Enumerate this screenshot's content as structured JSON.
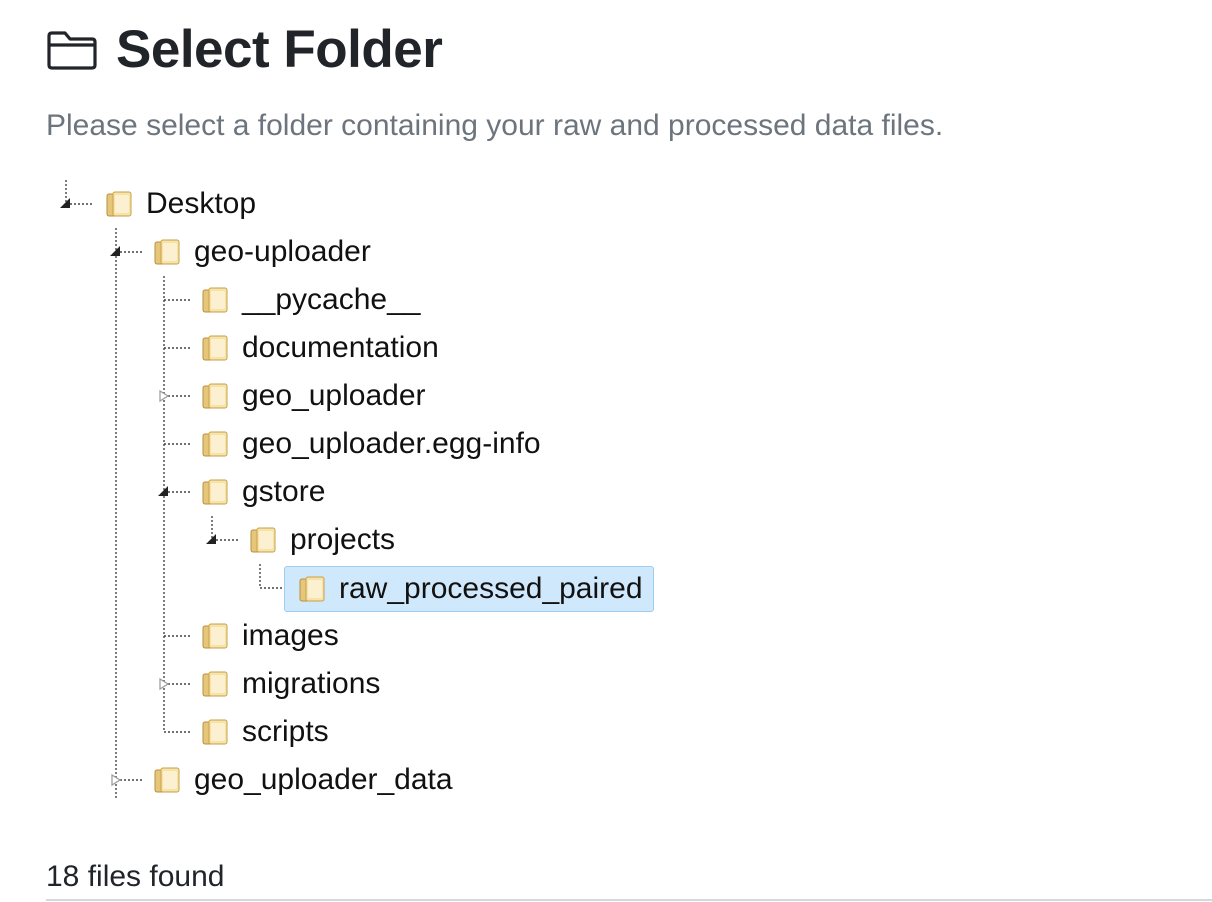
{
  "header": {
    "title": "Select Folder",
    "icon": "folder-outline-icon",
    "subtitle": "Please select a folder containing your raw and processed data files."
  },
  "tree": {
    "selected_color": "#cfe8fb",
    "nodes": [
      {
        "label": "Desktop",
        "state": "expanded"
      },
      {
        "label": "geo-uploader",
        "state": "expanded"
      },
      {
        "label": "__pycache__",
        "state": "leaf"
      },
      {
        "label": "documentation",
        "state": "leaf"
      },
      {
        "label": "geo_uploader",
        "state": "collapsed"
      },
      {
        "label": "geo_uploader.egg-info",
        "state": "leaf"
      },
      {
        "label": "gstore",
        "state": "expanded"
      },
      {
        "label": "projects",
        "state": "expanded"
      },
      {
        "label": "raw_processed_paired",
        "state": "selected"
      },
      {
        "label": "images",
        "state": "leaf"
      },
      {
        "label": "migrations",
        "state": "collapsed"
      },
      {
        "label": "scripts",
        "state": "leaf"
      },
      {
        "label": "geo_uploader_data",
        "state": "collapsed"
      }
    ]
  },
  "footer": {
    "status": "18 files found"
  }
}
